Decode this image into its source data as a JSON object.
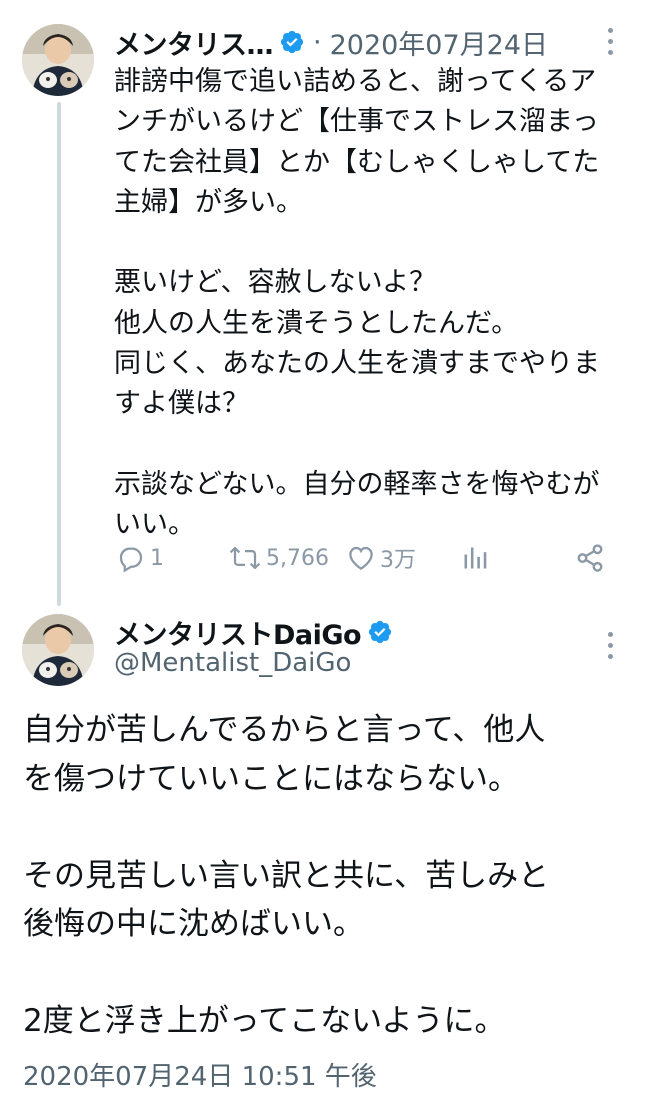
{
  "colors": {
    "verified_badge": "#1d9bf0",
    "text_primary": "#0f1419",
    "text_secondary": "#536471",
    "action_icon": "#8b98a5"
  },
  "reply_tweet": {
    "author_name": "メンタリス…",
    "separator": "·",
    "date": "2020年07月24日",
    "body": [
      [
        "誹謗中傷で追い詰めると、謝ってくるア",
        "ンチがいるけど【仕事でストレス溜まっ",
        "てた会社員】とか【むしゃくしゃしてた",
        "主婦】が多い。"
      ],
      [
        "悪いけど、容赦しないよ？",
        "他人の人生を潰そうとしたんだ。",
        "同じく、あなたの人生を潰すまでやりま",
        "すよ僕は？"
      ],
      [
        "示談などない。自分の軽率さを悔やむが",
        "いい。"
      ]
    ],
    "actions": {
      "reply_icon": "reply-icon",
      "reply_count": "1",
      "retweet_icon": "retweet-icon",
      "retweet_count": "5,766",
      "like_icon": "heart-icon",
      "like_count": "3万",
      "views_icon": "analytics-icon",
      "share_icon": "share-icon"
    }
  },
  "main_tweet": {
    "author_name": "メンタリストDaiGo",
    "handle": "@Mentalist_DaiGo",
    "body": [
      [
        "自分が苦しんでるからと言って、他人",
        "を傷つけていいことにはならない。"
      ],
      [
        "その見苦しい言い訳と共に、苦しみと",
        "後悔の中に沈めばいい。"
      ],
      [
        "2度と浮き上がってこないように。"
      ]
    ],
    "timestamp": "2020年07月24日 10:51 午後"
  }
}
